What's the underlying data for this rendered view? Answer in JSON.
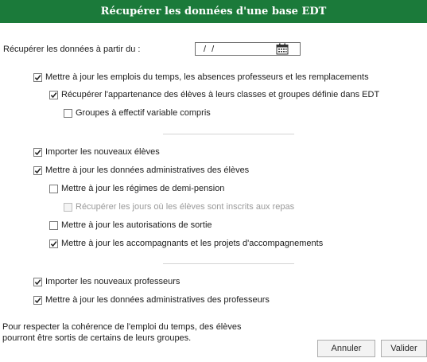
{
  "dialog": {
    "title": "Récupérer les données d'une base EDT"
  },
  "date_row": {
    "label": "Récupérer les données à partir du :",
    "value": "/ /"
  },
  "options": [
    {
      "label": "Mettre à jour les emplois du temps, les absences professeurs et les remplacements",
      "checked": true,
      "enabled": true
    },
    {
      "label": "Récupérer l'appartenance des élèves à leurs classes et groupes définie dans EDT",
      "checked": true,
      "enabled": true
    },
    {
      "label": "Groupes à effectif variable compris",
      "checked": false,
      "enabled": true
    },
    {
      "label": "Importer les nouveaux élèves",
      "checked": true,
      "enabled": true
    },
    {
      "label": "Mettre à jour les données administratives des élèves",
      "checked": true,
      "enabled": true
    },
    {
      "label": "Mettre à jour les régimes de demi-pension",
      "checked": false,
      "enabled": true
    },
    {
      "label": "Récupérer les jours où les élèves sont inscrits aux repas",
      "checked": false,
      "enabled": false
    },
    {
      "label": "Mettre à jour les autorisations de sortie",
      "checked": false,
      "enabled": true
    },
    {
      "label": "Mettre à jour les accompagnants et les projets d'accompagnements",
      "checked": true,
      "enabled": true
    },
    {
      "label": "Importer les nouveaux professeurs",
      "checked": true,
      "enabled": true
    },
    {
      "label": "Mettre à jour les données administratives des professeurs",
      "checked": true,
      "enabled": true
    }
  ],
  "note": {
    "line1": "Pour respecter la cohérence de l'emploi du temps, des élèves",
    "line2": "pourront être sortis de certains de leurs groupes."
  },
  "buttons": {
    "cancel": "Annuler",
    "ok": "Valider"
  },
  "colors": {
    "titlebar": "#1b7a3a",
    "checkmark": "#1f1f1f"
  }
}
